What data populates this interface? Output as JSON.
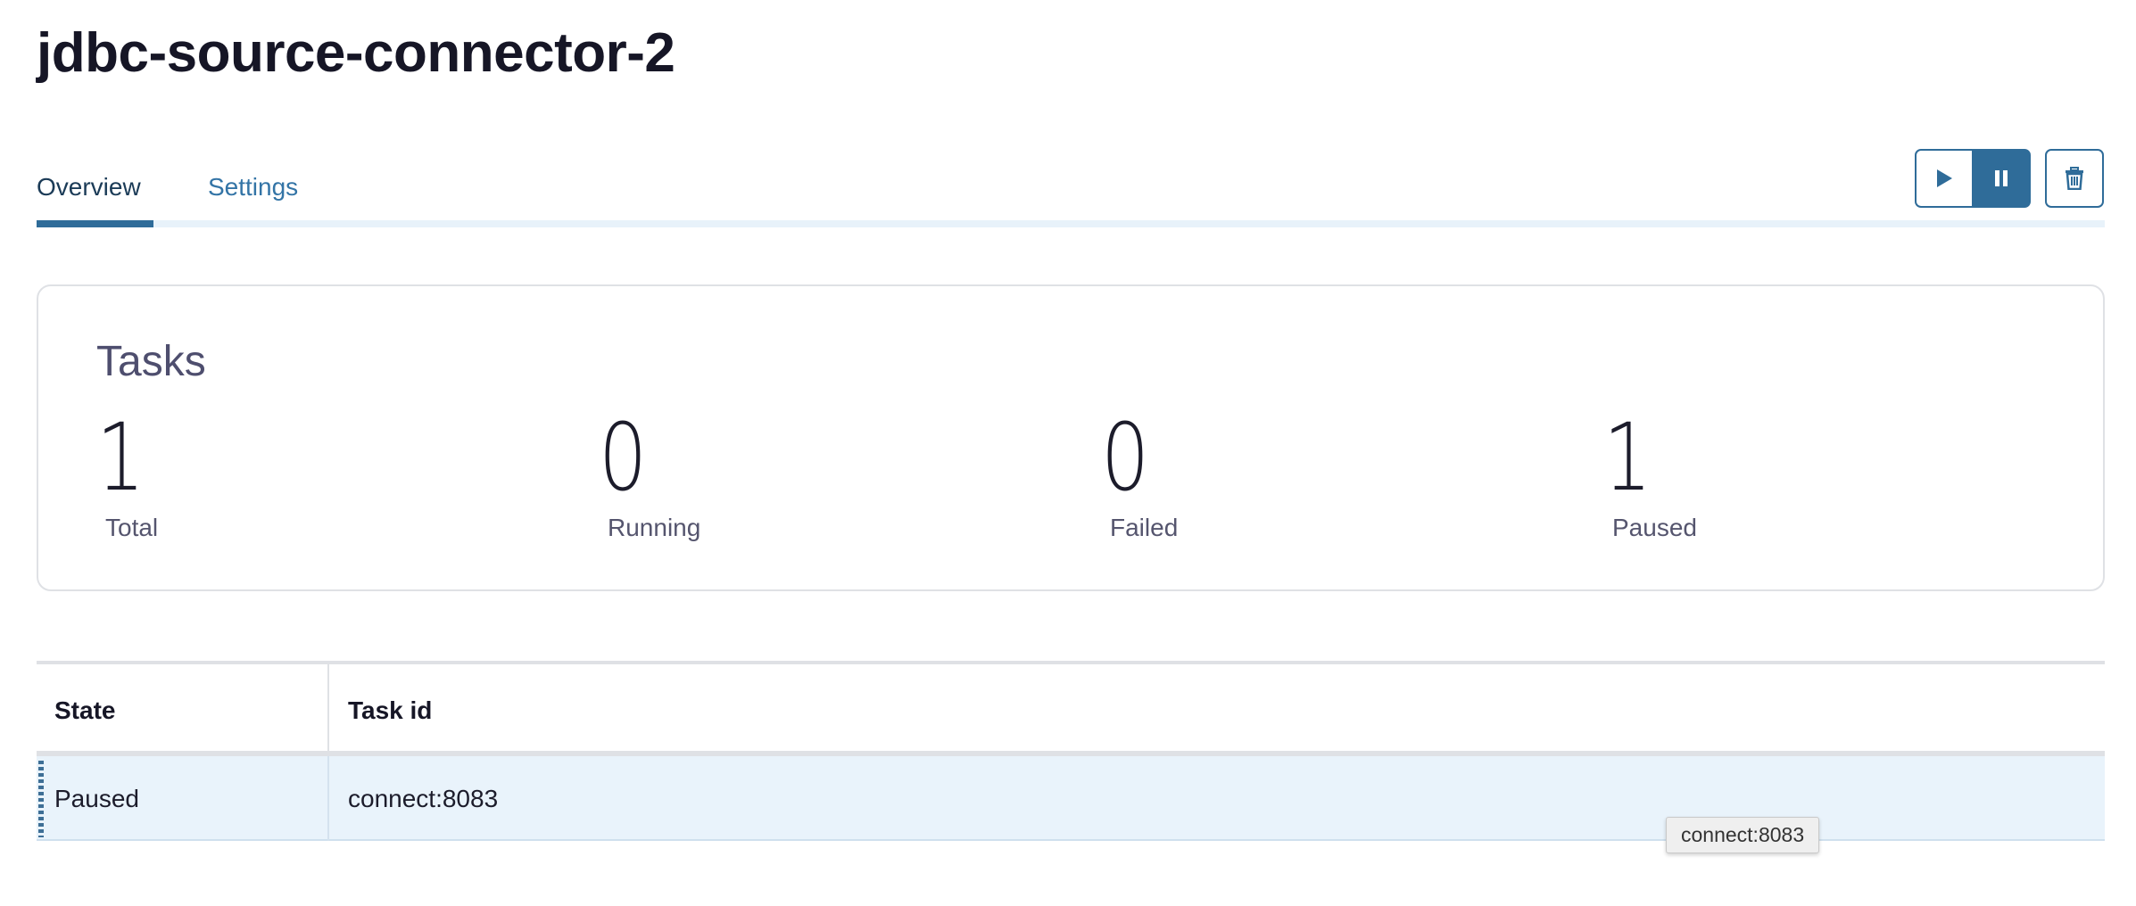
{
  "page": {
    "title": "jdbc-source-connector-2"
  },
  "tabs": [
    {
      "label": "Overview",
      "active": true
    },
    {
      "label": "Settings",
      "active": false
    }
  ],
  "actions": {
    "resume_icon": "play-icon",
    "pause_icon": "pause-icon",
    "delete_icon": "trash-icon",
    "accent_color": "#2f6c99"
  },
  "tasks": {
    "title": "Tasks",
    "stats": [
      {
        "value": "1",
        "label": "Total"
      },
      {
        "value": "0",
        "label": "Running"
      },
      {
        "value": "0",
        "label": "Failed"
      },
      {
        "value": "1",
        "label": "Paused"
      }
    ]
  },
  "table": {
    "columns": [
      "State",
      "Task id"
    ],
    "rows": [
      {
        "state": "Paused",
        "task_id": "connect:8083"
      }
    ]
  },
  "tooltip": {
    "text": "connect:8083"
  }
}
